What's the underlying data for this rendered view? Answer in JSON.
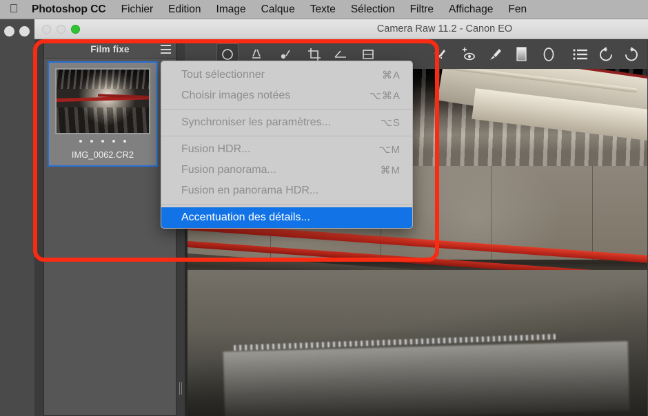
{
  "menubar": {
    "apple_icon": "apple-logo-icon",
    "items": [
      {
        "label": "Photoshop CC",
        "bold": true
      },
      {
        "label": "Fichier"
      },
      {
        "label": "Edition"
      },
      {
        "label": "Image"
      },
      {
        "label": "Calque"
      },
      {
        "label": "Texte"
      },
      {
        "label": "Sélection"
      },
      {
        "label": "Filtre"
      },
      {
        "label": "Affichage"
      },
      {
        "label": "Fen"
      }
    ]
  },
  "window": {
    "title": "Camera Raw 11.2  -  Canon EO",
    "traffic_lights": [
      "close",
      "minimize",
      "zoom"
    ]
  },
  "filmstrip": {
    "title": "Film fixe",
    "menu_icon": "hamburger-menu-icon",
    "thumbnail": {
      "filename": "IMG_0062.CR2",
      "rating_dots": 5,
      "selected": true
    }
  },
  "toolbar": {
    "tools": [
      {
        "name": "white-balance-tool",
        "selected": true
      },
      {
        "name": "color-sampler-tool"
      },
      {
        "name": "targeted-adjustment-tool"
      },
      {
        "name": "crop-tool"
      },
      {
        "name": "straighten-tool"
      },
      {
        "name": "transform-tool"
      },
      {
        "name": "spot-removal-tool"
      },
      {
        "name": "red-eye-removal-tool"
      },
      {
        "name": "adjustment-brush-tool"
      },
      {
        "name": "graduated-filter-tool"
      },
      {
        "name": "radial-filter-tool"
      },
      {
        "name": "preferences-tool"
      },
      {
        "name": "rotate-counterclockwise-tool"
      },
      {
        "name": "rotate-clockwise-tool"
      }
    ]
  },
  "dropdown": {
    "items": [
      {
        "label": "Tout sélectionner",
        "shortcut": "⌘A",
        "state": "disabled"
      },
      {
        "label": "Choisir images notées",
        "shortcut": "⌥⌘A",
        "state": "disabled"
      },
      {
        "separator": true
      },
      {
        "label": "Synchroniser les paramètres...",
        "shortcut": "⌥S",
        "state": "disabled"
      },
      {
        "separator": true
      },
      {
        "label": "Fusion HDR...",
        "shortcut": "⌥M",
        "state": "disabled"
      },
      {
        "label": "Fusion panorama...",
        "shortcut": "⌘M",
        "state": "disabled"
      },
      {
        "label": "Fusion en panorama HDR...",
        "shortcut": "",
        "state": "disabled"
      },
      {
        "separator": true
      },
      {
        "label": "Accentuation des détails...",
        "shortcut": "",
        "state": "highlighted"
      }
    ]
  },
  "annotation": {
    "shape": "rounded-rectangle-highlight",
    "color": "#f92b12"
  },
  "preview": {
    "overlay_marker": "spot-removal-marker"
  }
}
